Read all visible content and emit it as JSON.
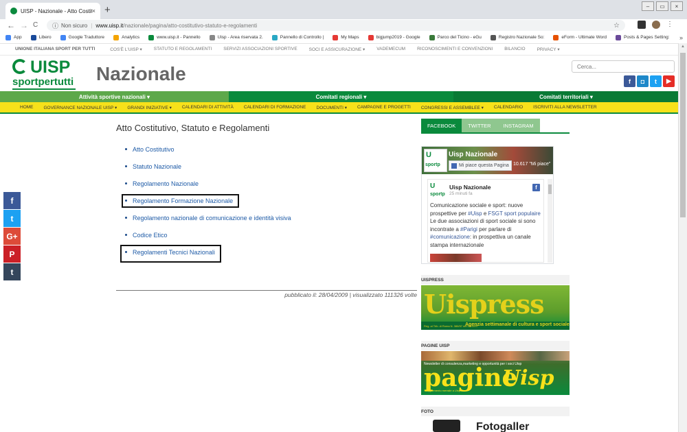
{
  "browser": {
    "tab_title": "UISP - Nazionale - Atto Costitutivo, ...",
    "tab_close": "×",
    "new_tab": "+",
    "back": "←",
    "forward": "→",
    "reload": "C",
    "not_secure": "Non sicuro",
    "separator": "|",
    "url_domain": "www.uisp.it",
    "url_path": "/nazionale/pagina/atto-costitutivo-statuto-e-regolamenti",
    "star": "☆",
    "menu": "⋮",
    "win_min": "–",
    "win_max": "▭",
    "win_close": "×",
    "bookmarks": [
      {
        "label": "App",
        "color": "#4285f4"
      },
      {
        "label": "Libero",
        "color": "#1a4a9a"
      },
      {
        "label": "Google Traduttore",
        "color": "#4285f4"
      },
      {
        "label": "Analytics",
        "color": "#f4a400"
      },
      {
        "label": "www.uisp.it - Pannello",
        "color": "#0a8a3c"
      },
      {
        "label": "Uisp - Area riservata 2.",
        "color": "#888888"
      },
      {
        "label": "Pannello di Controllo |",
        "color": "#2aa8c4"
      },
      {
        "label": "My Maps",
        "color": "#e53935"
      },
      {
        "label": "bigjump2019 - Google",
        "color": "#e53935"
      },
      {
        "label": "Parco del Ticino - eGu",
        "color": "#3a7a3a"
      },
      {
        "label": "Registro Nazionale So:",
        "color": "#555555"
      },
      {
        "label": "eForm - Ultimate Word",
        "color": "#e65100"
      },
      {
        "label": "Posts & Pages Setting:",
        "color": "#6a4a9a"
      }
    ],
    "bookmarks_more": "»"
  },
  "site": {
    "topbar_brand": "UNIONE ITALIANA SPORT PER TUTTI",
    "topbar_items": [
      "COS'È L'UISP ▾",
      "STATUTO E REGOLAMENTI",
      "SERVIZI ASSOCIAZIONI SPORTIVE",
      "SOCI E ASSICURAZIONE ▾",
      "VADEMECUM",
      "RICONOSCIMENTI E CONVENZIONI",
      "BILANCIO",
      "PRIVACY ▾"
    ],
    "logo_uisp": "UISP",
    "logo_sportpertutti": "sportpertutti",
    "title": "Nazionale",
    "search_placeholder": "Cerca...",
    "social_fb": "f",
    "social_ig": "◘",
    "social_tw": "t",
    "social_yt": "▶",
    "menu1": [
      {
        "label": "Attività sportive nazionali ▾",
        "color": "#5da84a"
      },
      {
        "label": "Comitati regionali ▾",
        "color": "#0a8a3c"
      },
      {
        "label": "Comitati territoriali ▾",
        "color": "#0a7a35"
      }
    ],
    "menu2": [
      "HOME",
      "GOVERNANCE NAZIONALE UISP ▾",
      "GRANDI INIZIATIVE ▾",
      "CALENDARI DI ATTIVITÀ",
      "CALENDARI DI FORMAZIONE",
      "DOCUMENTI ▾",
      "CAMPAGNE E PROGETTI",
      "CONGRESSI E ASSEMBLEE ▾",
      "CALENDARIO",
      "ISCRIVITI ALLA NEWSLETTER"
    ]
  },
  "share": [
    {
      "label": "f",
      "color": "#3b5998"
    },
    {
      "label": "t",
      "color": "#1da1f2"
    },
    {
      "label": "G+",
      "color": "#dd4b39"
    },
    {
      "label": "P",
      "color": "#cb2027"
    },
    {
      "label": "t",
      "color": "#35465c"
    }
  ],
  "content": {
    "heading": "Atto Costitutivo, Statuto e Regolamenti",
    "documents": [
      "Atto Costitutivo",
      "Statuto Nazionale",
      "Regolamento Nazionale",
      "Regolamento Formazione Nazionale",
      "Regolamento nazionale di comunicazione e identità visiva",
      "Codice Etico",
      "Regolamenti Tecnici Nazionali"
    ],
    "published": "pubblicato il: 28/04/2009 | visualizzato 111326 volte"
  },
  "sidebar": {
    "tabs": [
      {
        "label": "FACEBOOK",
        "color": "#0a8a3c"
      },
      {
        "label": "TWITTER",
        "color": "#8fc78f"
      },
      {
        "label": "INSTAGRAM",
        "color": "#8fc78f"
      }
    ],
    "fb_page_name": "Uisp Nazionale",
    "fb_like_button": "Mi piace questa Pagina",
    "fb_like_count": "10.617 \"Mi piace\"",
    "fb_logo_u": "U",
    "fb_logo_sub": "sportp",
    "fb_post_author": "Uisp Nazionale",
    "fb_post_time": "25 minuti fa",
    "fb_icon": "f",
    "fb_post_text_1": "Comunicazione sociale e sport: nuove prospettive per ",
    "fb_post_tag_1": "#Uisp",
    "fb_post_text_2": " e ",
    "fb_post_tag_2": "FSGT sport populaire",
    "fb_post_text_3": "Le due associazioni di sport sociale si sono incontrate a ",
    "fb_post_tag_3": "#Parigi",
    "fb_post_text_4": " per parlare di ",
    "fb_post_tag_4": "#comunicazione",
    "fb_post_text_5": ": in prospettiva un canale stampa internazionale",
    "uispress_header": "UISPRESS",
    "uispress_title": "Uispress",
    "uispress_sub": "Agenzia settimanale di cultura e sport sociale",
    "uispress_small": "Reg. al Trib. di Roma N. 388/97 del 21/11/97",
    "pagine_header": "PAGINE UISP",
    "pagine_sub": "Newsletter di consulenza,marketing e opportunità per i soci Uisp",
    "pagine_title": "pagine",
    "pagine_title2": "Uisp",
    "pagine_foot": "Supplemento mensile a Uispress",
    "foto_header": "FOTO",
    "foto_text": "Fotogaller"
  }
}
